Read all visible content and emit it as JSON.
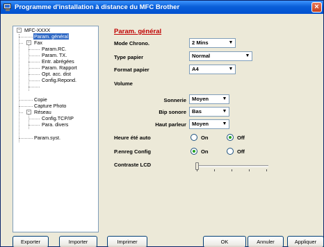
{
  "window": {
    "title": "Programme d'installation à distance du MFC Brother",
    "close_glyph": "×"
  },
  "tree": {
    "root": "MFC-XXXX",
    "items": [
      {
        "label": "Param. général",
        "selected": true
      },
      {
        "label": "Fax"
      },
      {
        "label": "Param.RC."
      },
      {
        "label": "Param. TX."
      },
      {
        "label": "Entr. abrégées"
      },
      {
        "label": "Param. Rapport"
      },
      {
        "label": "Opt. acc. dist"
      },
      {
        "label": "Config.Repond."
      },
      {
        "label": "Copie"
      },
      {
        "label": "Capture Photo"
      },
      {
        "label": "Réseau"
      },
      {
        "label": "Config.TCP/IP"
      },
      {
        "label": "Para. divers"
      },
      {
        "label": "Param.syst."
      }
    ],
    "expander_glyph": "-"
  },
  "panel": {
    "title": "Param. général",
    "mode_chrono": {
      "label": "Mode Chrono.",
      "value": "2 Mins"
    },
    "type_papier": {
      "label": "Type papier",
      "value": "Normal"
    },
    "format_papier": {
      "label": "Format papier",
      "value": "A4"
    },
    "volume": {
      "label": "Volume"
    },
    "sonnerie": {
      "label": "Sonnerie",
      "value": "Moyen"
    },
    "bip_sonore": {
      "label": "Bip sonore",
      "value": "Bas"
    },
    "haut_parleur": {
      "label": "Haut parleur",
      "value": "Moyen"
    },
    "heure_ete": {
      "label": "Heure été auto",
      "on": "On",
      "off": "Off",
      "selected": "off"
    },
    "p_enreg": {
      "label": "P.enreg Config",
      "on": "On",
      "off": "Off",
      "selected": "on"
    },
    "contraste": {
      "label": "Contraste LCD",
      "level": 0
    }
  },
  "dropdown_glyph": "▼",
  "buttons": {
    "exporter": "Exporter",
    "importer": "Importer",
    "imprimer": "Imprimer",
    "ok": "OK",
    "annuler": "Annuler",
    "appliquer": "Appliquer"
  },
  "colors": {
    "title_bar": "#0050d0",
    "section_title": "#c00000",
    "selection": "#316ac5"
  }
}
